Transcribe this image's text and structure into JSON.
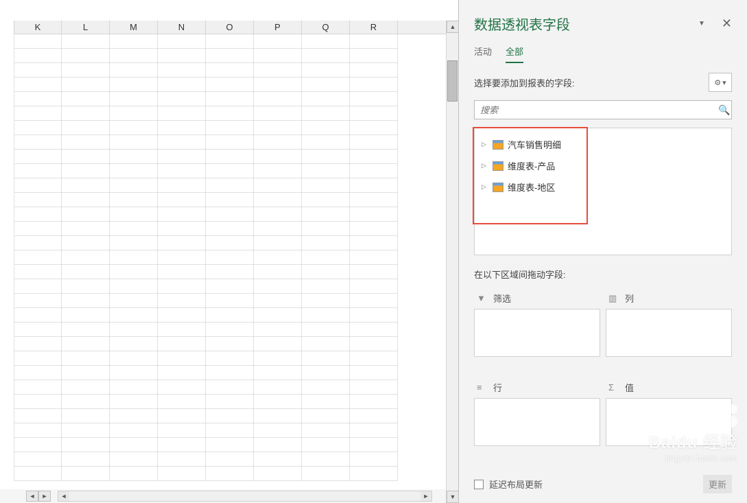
{
  "columns": [
    "K",
    "L",
    "M",
    "N",
    "O",
    "P",
    "Q",
    "R"
  ],
  "pane": {
    "title": "数据透视表字段",
    "tabs": {
      "active": "活动",
      "all": "全部"
    },
    "field_prompt": "选择要添加到报表的字段:",
    "search_placeholder": "搜索",
    "fields": [
      "汽车销售明细",
      "维度表-产品",
      "维度表-地区"
    ],
    "drag_prompt": "在以下区域间拖动字段:",
    "zones": {
      "filter": "筛选",
      "columns": "列",
      "rows": "行",
      "values": "值"
    },
    "defer_label": "延迟布局更新",
    "update_label": "更新"
  },
  "watermark": {
    "line1": "Baidu 经验",
    "line2": "jingyan.baidu.com"
  }
}
